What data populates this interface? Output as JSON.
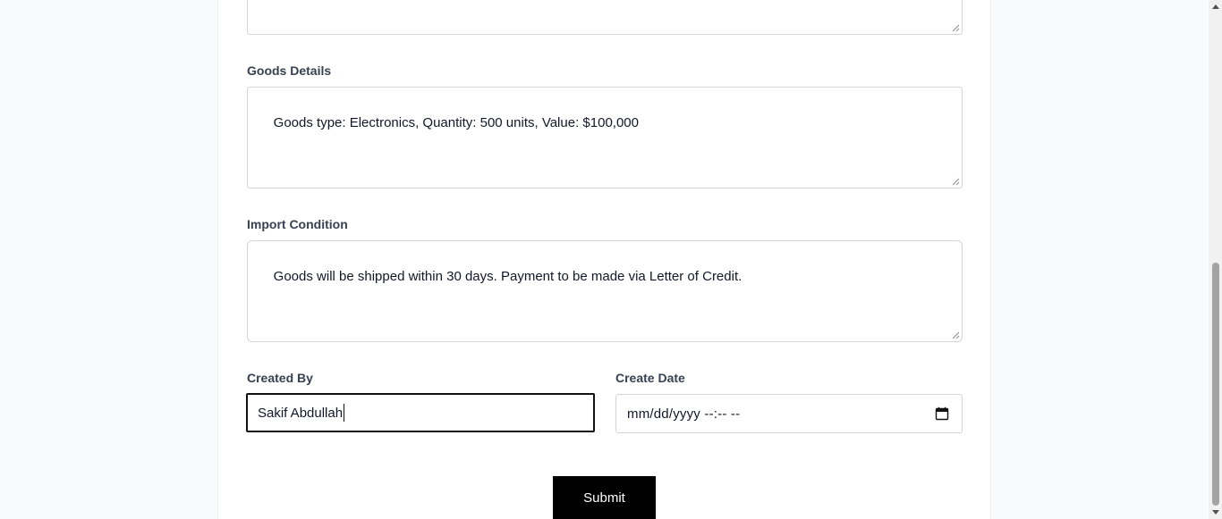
{
  "form": {
    "goods_details": {
      "label": "Goods Details",
      "value": "Goods type: Electronics, Quantity: 500 units, Value: $100,000"
    },
    "import_condition": {
      "label": "Import Condition",
      "value": "Goods will be shipped within 30 days. Payment to be made via Letter of Credit."
    },
    "created_by": {
      "label": "Created By",
      "value": "Sakif Abdullah"
    },
    "create_date": {
      "label": "Create Date",
      "placeholder": "mm/dd/yyyy --:-- --"
    },
    "submit_label": "Submit"
  },
  "icons": {
    "calendar": "calendar-icon",
    "resize": "resize-handle-icon",
    "scroll_up": "chevron-up-icon",
    "scroll_down": "chevron-down-icon"
  },
  "colors": {
    "submit_bg": "#000000",
    "submit_text": "#ffffff",
    "focus_border": "#111111",
    "field_border": "#d1d5db"
  }
}
